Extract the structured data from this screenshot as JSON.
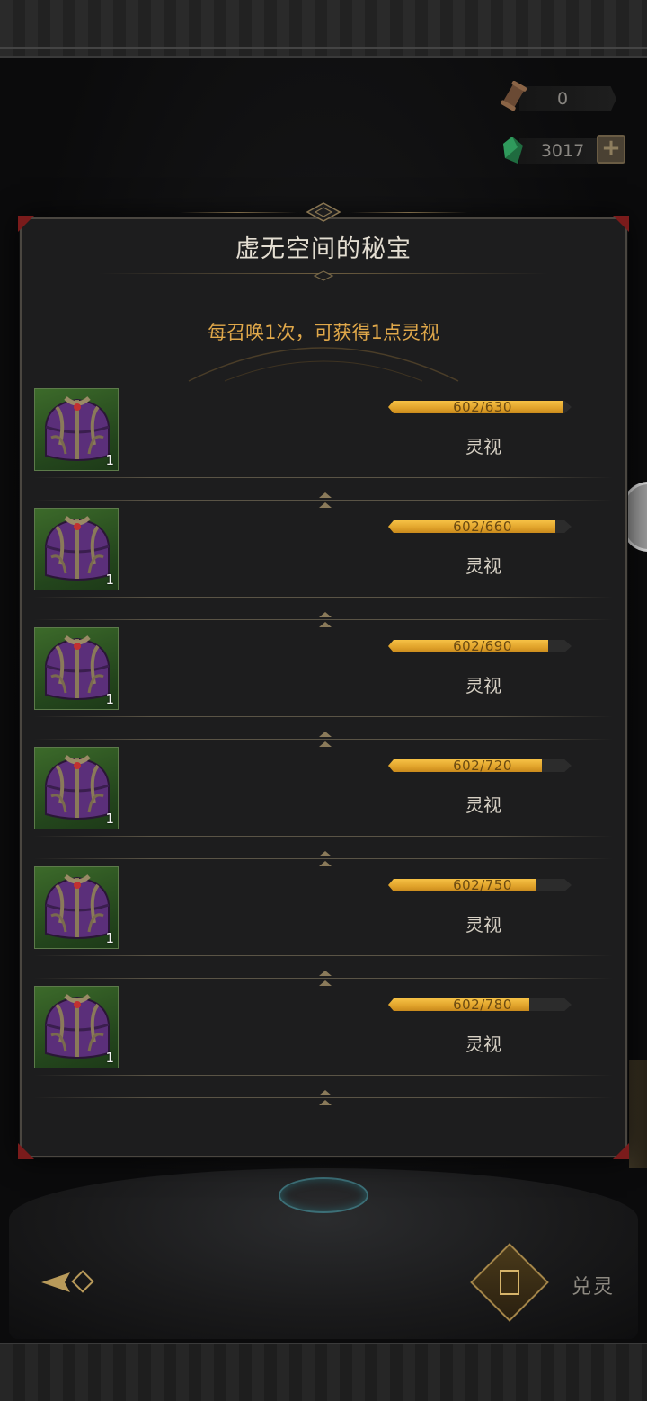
{
  "currencies": [
    {
      "icon": "scroll-icon",
      "value": "0"
    },
    {
      "icon": "crystal-icon",
      "value": "3017"
    }
  ],
  "dialog": {
    "title": "虚无空间的秘宝",
    "hint": "每召唤1次，可获得1点灵视"
  },
  "rewards": [
    {
      "icon": "treasure-chest-icon",
      "count": "1",
      "progress": "602/630",
      "progress_fraction": 0.956,
      "name": "灵视"
    },
    {
      "icon": "treasure-chest-icon",
      "count": "1",
      "progress": "602/660",
      "progress_fraction": 0.912,
      "name": "灵视"
    },
    {
      "icon": "treasure-chest-icon",
      "count": "1",
      "progress": "602/690",
      "progress_fraction": 0.872,
      "name": "灵视"
    },
    {
      "icon": "treasure-chest-icon",
      "count": "1",
      "progress": "602/720",
      "progress_fraction": 0.836,
      "name": "灵视"
    },
    {
      "icon": "treasure-chest-icon",
      "count": "1",
      "progress": "602/750",
      "progress_fraction": 0.803,
      "name": "灵视"
    },
    {
      "icon": "treasure-chest-icon",
      "count": "1",
      "progress": "602/780",
      "progress_fraction": 0.772,
      "name": "灵视"
    }
  ],
  "footer": {
    "convert_label": "兑灵"
  },
  "colors": {
    "accent_gold": "#e0a84a",
    "progress_fill": "#f0b43a",
    "tile_green": "#2f5a22",
    "corner_red": "#7a1b1b"
  }
}
